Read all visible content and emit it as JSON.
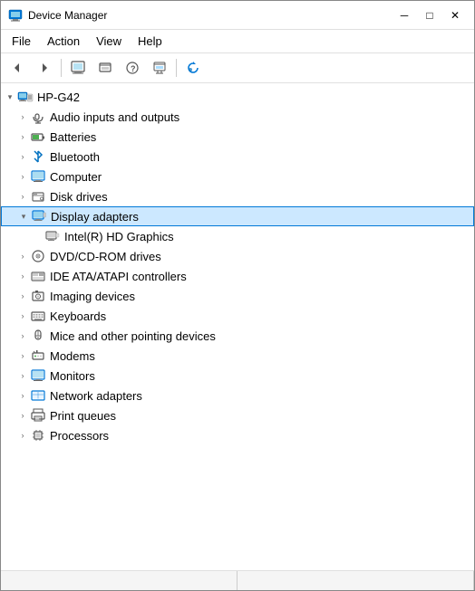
{
  "window": {
    "title": "Device Manager",
    "title_icon": "🖥️",
    "buttons": {
      "minimize": "─",
      "maximize": "□",
      "close": "✕"
    }
  },
  "menu": {
    "items": [
      "File",
      "Action",
      "View",
      "Help"
    ]
  },
  "toolbar": {
    "buttons": [
      "◀",
      "▶",
      "⊞",
      "☰",
      "?",
      "☑",
      "🔄"
    ]
  },
  "tree": {
    "root": {
      "label": "HP-G42",
      "expanded": true,
      "icon": "🖥️"
    },
    "items": [
      {
        "id": "audio",
        "label": "Audio inputs and outputs",
        "icon": "🔊",
        "indent": 1,
        "expanded": false,
        "has_children": true
      },
      {
        "id": "batteries",
        "label": "Batteries",
        "icon": "🔋",
        "indent": 1,
        "expanded": false,
        "has_children": true
      },
      {
        "id": "bluetooth",
        "label": "Bluetooth",
        "icon": "🔵",
        "indent": 1,
        "expanded": false,
        "has_children": true
      },
      {
        "id": "computer",
        "label": "Computer",
        "icon": "💻",
        "indent": 1,
        "expanded": false,
        "has_children": true
      },
      {
        "id": "disk",
        "label": "Disk drives",
        "icon": "💾",
        "indent": 1,
        "expanded": false,
        "has_children": true
      },
      {
        "id": "display",
        "label": "Display adapters",
        "icon": "🖥️",
        "indent": 1,
        "expanded": true,
        "has_children": true,
        "selected": true
      },
      {
        "id": "intel",
        "label": "Intel(R) HD Graphics",
        "icon": "📺",
        "indent": 2,
        "expanded": false,
        "has_children": false
      },
      {
        "id": "dvd",
        "label": "DVD/CD-ROM drives",
        "icon": "💿",
        "indent": 1,
        "expanded": false,
        "has_children": true
      },
      {
        "id": "ide",
        "label": "IDE ATA/ATAPI controllers",
        "icon": "🔧",
        "indent": 1,
        "expanded": false,
        "has_children": true
      },
      {
        "id": "imaging",
        "label": "Imaging devices",
        "icon": "📷",
        "indent": 1,
        "expanded": false,
        "has_children": true
      },
      {
        "id": "keyboards",
        "label": "Keyboards",
        "icon": "⌨️",
        "indent": 1,
        "expanded": false,
        "has_children": true
      },
      {
        "id": "mice",
        "label": "Mice and other pointing devices",
        "icon": "🖱️",
        "indent": 1,
        "expanded": false,
        "has_children": true
      },
      {
        "id": "modems",
        "label": "Modems",
        "icon": "📟",
        "indent": 1,
        "expanded": false,
        "has_children": true
      },
      {
        "id": "monitors",
        "label": "Monitors",
        "icon": "🖥️",
        "indent": 1,
        "expanded": false,
        "has_children": true
      },
      {
        "id": "network",
        "label": "Network adapters",
        "icon": "🌐",
        "indent": 1,
        "expanded": false,
        "has_children": true
      },
      {
        "id": "print",
        "label": "Print queues",
        "icon": "🖨️",
        "indent": 1,
        "expanded": false,
        "has_children": true
      },
      {
        "id": "processors",
        "label": "Processors",
        "icon": "⚙️",
        "indent": 1,
        "expanded": false,
        "has_children": true
      }
    ]
  },
  "statusbar": {
    "panes": [
      "",
      ""
    ]
  }
}
